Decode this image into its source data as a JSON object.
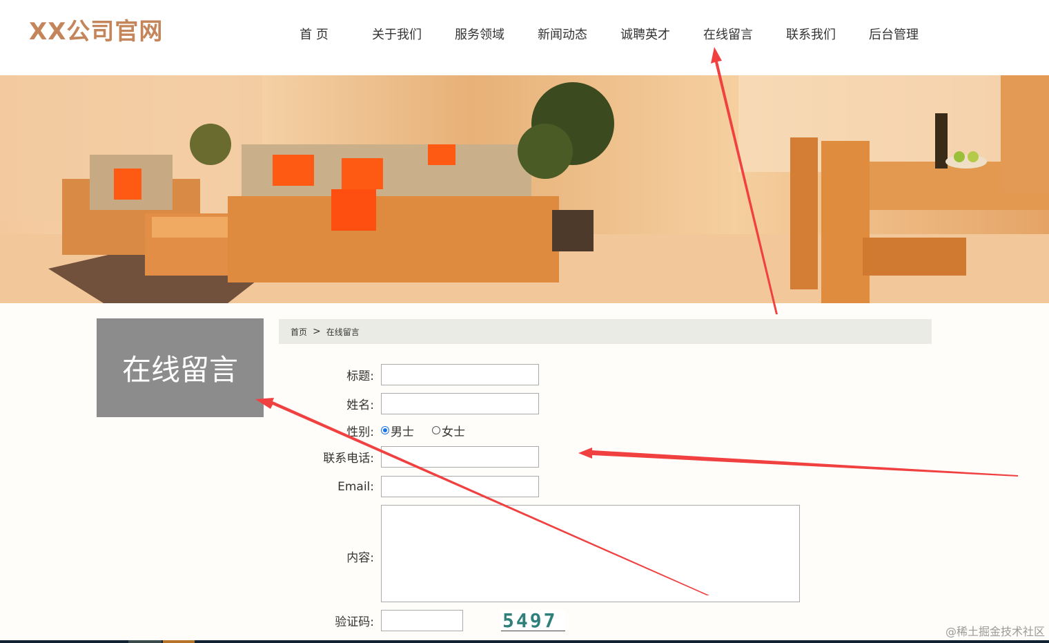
{
  "header": {
    "logo": "XX公司官网",
    "nav": [
      "首 页",
      "关于我们",
      "服务领域",
      "新闻动态",
      "诚聘英才",
      "在线留言",
      "联系我们",
      "后台管理"
    ]
  },
  "sidebar": {
    "title": "在线留言"
  },
  "breadcrumb": {
    "home": "首页",
    "separator": ">",
    "current": "在线留言"
  },
  "form": {
    "title_label": "标题:",
    "name_label": "姓名:",
    "gender_label": "性别:",
    "gender_options": [
      "男士",
      "女士"
    ],
    "gender_selected": "男士",
    "phone_label": "联系电话:",
    "email_label": "Email:",
    "content_label": "内容:",
    "captcha_label": "验证码:",
    "captcha_text": "5497"
  },
  "watermark": "@稀土掘金技术社区",
  "colors": {
    "logo": "#c4855b",
    "sidebar_bg": "#8c8c8c",
    "breadcrumb_bg": "#ebebe6",
    "annotation": "#f04040"
  }
}
